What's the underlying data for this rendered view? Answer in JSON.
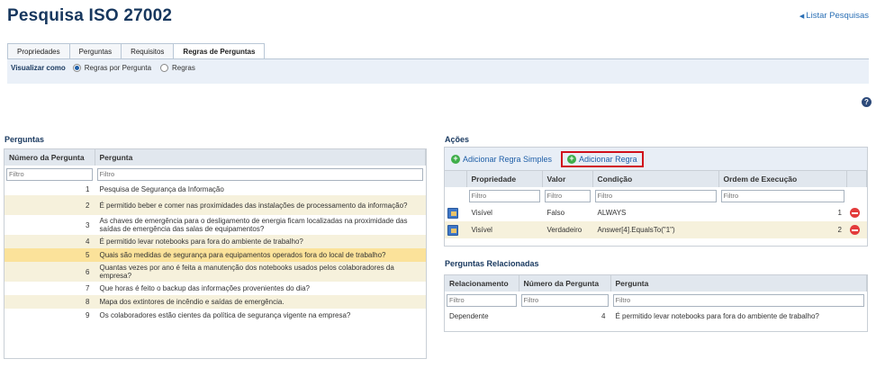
{
  "header": {
    "title": "Pesquisa ISO 27002",
    "back_link": "Listar Pesquisas"
  },
  "tabs": [
    "Propriedades",
    "Perguntas",
    "Requisitos",
    "Regras de Perguntas"
  ],
  "view": {
    "label": "Visualizar como",
    "option1": "Regras por Pergunta",
    "option2": "Regras"
  },
  "questions": {
    "title": "Perguntas",
    "col_number": "Número da Pergunta",
    "col_question": "Pergunta",
    "filter_placeholder": "Filtro",
    "rows": [
      {
        "n": "1",
        "text": "Pesquisa de Segurança da Informação"
      },
      {
        "n": "2",
        "text": "É permitido beber e comer nas proximidades das instalações de processamento da informação?"
      },
      {
        "n": "3",
        "text": "As chaves de emergência para o desligamento de energia ficam localizadas na proximidade das saídas de emergência das salas de equipamentos?"
      },
      {
        "n": "4",
        "text": "É permitido levar notebooks para fora do ambiente de trabalho?"
      },
      {
        "n": "5",
        "text": "Quais são medidas de segurança para equipamentos operados fora do local de trabalho?"
      },
      {
        "n": "6",
        "text": "Quantas vezes por ano é feita a manutenção dos notebooks usados pelos colaboradores da empresa?"
      },
      {
        "n": "7",
        "text": "Que horas é feito o backup das informações provenientes do dia?"
      },
      {
        "n": "8",
        "text": "Mapa dos extintores de incêndio e saídas de emergência."
      },
      {
        "n": "9",
        "text": "Os colaboradores estão cientes da política de segurança vigente na empresa?"
      }
    ]
  },
  "actions": {
    "title": "Ações",
    "add_simple": "Adicionar Regra Simples",
    "add_rule": "Adicionar Regra",
    "col_property": "Propriedade",
    "col_value": "Valor",
    "col_condition": "Condição",
    "col_order": "Ordem de Execução",
    "filter_placeholder": "Filtro",
    "rows": [
      {
        "property": "Visível",
        "value": "Falso",
        "condition": "ALWAYS",
        "order": "1"
      },
      {
        "property": "Visível",
        "value": "Verdadeiro",
        "condition": "Answer[4].EqualsTo(\"1\")",
        "order": "2"
      }
    ]
  },
  "related": {
    "title": "Perguntas Relacionadas",
    "col_relation": "Relacionamento",
    "col_number": "Número da Pergunta",
    "col_question": "Pergunta",
    "filter_placeholder": "Filtro",
    "rows": [
      {
        "relation": "Dependente",
        "n": "4",
        "text": "É permitido levar notebooks para fora do ambiente de trabalho?"
      }
    ]
  },
  "colors": {
    "title": "#17375e",
    "link": "#2a6fb5",
    "selected_row": "#fbe29a",
    "alt_row": "#f6f1dc",
    "highlight_border": "#d0101b",
    "add_icon": "#3fae4a",
    "delete_icon": "#e33b3b"
  },
  "icons": [
    "triangle-left-icon",
    "help-icon",
    "add-icon",
    "edit-icon",
    "delete-icon"
  ]
}
